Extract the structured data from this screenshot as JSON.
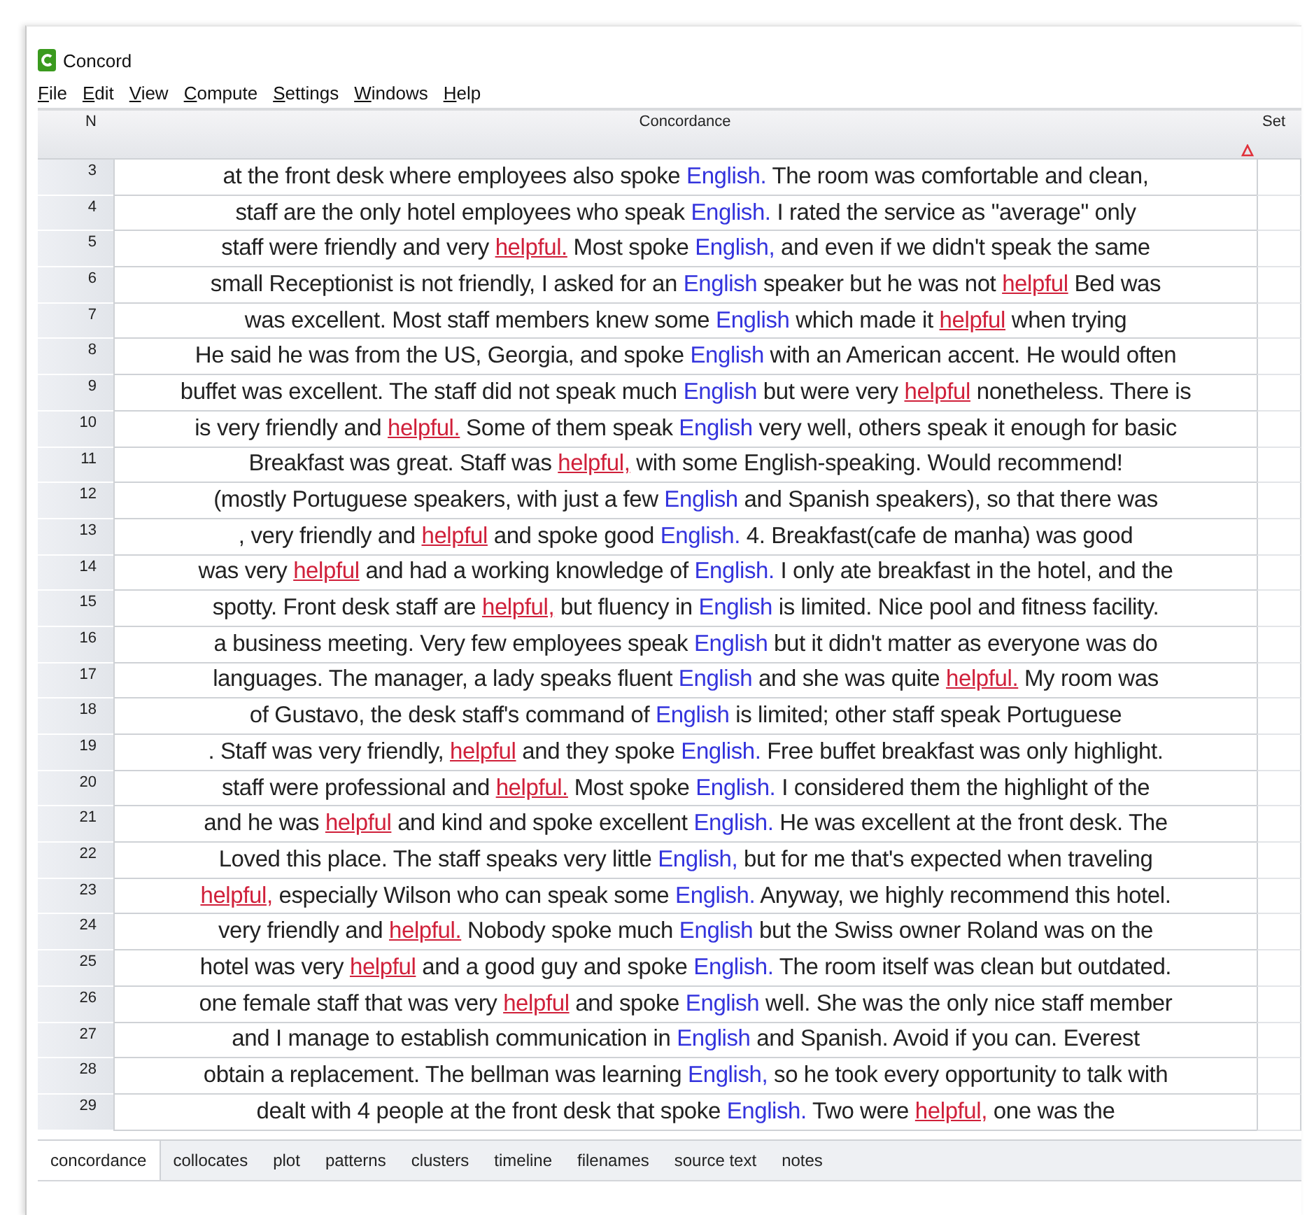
{
  "window": {
    "title": "Concord"
  },
  "menu": [
    {
      "label": "File"
    },
    {
      "label": "Edit"
    },
    {
      "label": "View"
    },
    {
      "label": "Compute"
    },
    {
      "label": "Settings"
    },
    {
      "label": "Windows"
    },
    {
      "label": "Help"
    }
  ],
  "table": {
    "columns": [
      "N",
      "Concordance",
      "Set"
    ],
    "rows": [
      {
        "n": "3",
        "segments": [
          {
            "kind": "plain",
            "text": "at the front desk where employees also spoke "
          },
          {
            "kind": "node",
            "text": "English."
          },
          {
            "kind": "plain",
            "text": " The room was comfortable and clean,"
          }
        ]
      },
      {
        "n": "4",
        "segments": [
          {
            "kind": "plain",
            "text": "staff are the only hotel employees who speak "
          },
          {
            "kind": "node",
            "text": "English."
          },
          {
            "kind": "plain",
            "text": " I rated the service as \"average\" only"
          }
        ]
      },
      {
        "n": "5",
        "segments": [
          {
            "kind": "plain",
            "text": "staff were friendly and very "
          },
          {
            "kind": "collocate",
            "text": "helpful."
          },
          {
            "kind": "plain",
            "text": " Most spoke "
          },
          {
            "kind": "node",
            "text": "English,"
          },
          {
            "kind": "plain",
            "text": " and even if we didn't speak the same"
          }
        ]
      },
      {
        "n": "6",
        "segments": [
          {
            "kind": "plain",
            "text": "small Receptionist is not friendly, I asked for an "
          },
          {
            "kind": "node",
            "text": "English"
          },
          {
            "kind": "plain",
            "text": " speaker but he was not "
          },
          {
            "kind": "collocate",
            "text": "helpful"
          },
          {
            "kind": "plain",
            "text": " Bed was"
          }
        ]
      },
      {
        "n": "7",
        "segments": [
          {
            "kind": "plain",
            "text": "was excellent. Most staff members knew some "
          },
          {
            "kind": "node",
            "text": "English"
          },
          {
            "kind": "plain",
            "text": " which made it "
          },
          {
            "kind": "collocate",
            "text": "helpful"
          },
          {
            "kind": "plain",
            "text": " when trying"
          }
        ]
      },
      {
        "n": "8",
        "segments": [
          {
            "kind": "plain",
            "text": "He said he was from the US, Georgia, and spoke "
          },
          {
            "kind": "node",
            "text": "English"
          },
          {
            "kind": "plain",
            "text": " with an American accent. He would often"
          }
        ]
      },
      {
        "n": "9",
        "segments": [
          {
            "kind": "plain",
            "text": "buffet was excellent. The staff did not speak much "
          },
          {
            "kind": "node",
            "text": "English"
          },
          {
            "kind": "plain",
            "text": " but were very "
          },
          {
            "kind": "collocate",
            "text": "helpful"
          },
          {
            "kind": "plain",
            "text": " nonetheless. There is"
          }
        ]
      },
      {
        "n": "10",
        "segments": [
          {
            "kind": "plain",
            "text": "is very friendly and "
          },
          {
            "kind": "collocate",
            "text": "helpful."
          },
          {
            "kind": "plain",
            "text": " Some of them speak "
          },
          {
            "kind": "node",
            "text": "English"
          },
          {
            "kind": "plain",
            "text": " very well, others speak it enough for basic"
          }
        ]
      },
      {
        "n": "11",
        "segments": [
          {
            "kind": "plain",
            "text": "Breakfast was great. Staff was "
          },
          {
            "kind": "collocate",
            "text": "helpful,"
          },
          {
            "kind": "plain",
            "text": " with some English-speaking. Would recommend!"
          }
        ]
      },
      {
        "n": "12",
        "segments": [
          {
            "kind": "plain",
            "text": "(mostly Portuguese speakers, with just a few "
          },
          {
            "kind": "node",
            "text": "English"
          },
          {
            "kind": "plain",
            "text": " and Spanish speakers), so that there was"
          }
        ]
      },
      {
        "n": "13",
        "segments": [
          {
            "kind": "plain",
            "text": ", very friendly and "
          },
          {
            "kind": "collocate",
            "text": "helpful"
          },
          {
            "kind": "plain",
            "text": " and spoke good "
          },
          {
            "kind": "node",
            "text": "English."
          },
          {
            "kind": "plain",
            "text": " 4. Breakfast(cafe de manha) was good"
          }
        ]
      },
      {
        "n": "14",
        "segments": [
          {
            "kind": "plain",
            "text": "was very "
          },
          {
            "kind": "collocate",
            "text": "helpful"
          },
          {
            "kind": "plain",
            "text": " and had a working knowledge of "
          },
          {
            "kind": "node",
            "text": "English."
          },
          {
            "kind": "plain",
            "text": " I only ate breakfast in the hotel, and the"
          }
        ]
      },
      {
        "n": "15",
        "segments": [
          {
            "kind": "plain",
            "text": "spotty. Front desk staff are "
          },
          {
            "kind": "collocate",
            "text": "helpful,"
          },
          {
            "kind": "plain",
            "text": " but fluency in "
          },
          {
            "kind": "node",
            "text": "English"
          },
          {
            "kind": "plain",
            "text": " is limited. Nice pool and fitness facility."
          }
        ]
      },
      {
        "n": "16",
        "segments": [
          {
            "kind": "plain",
            "text": "a business meeting. Very few employees speak "
          },
          {
            "kind": "node",
            "text": "English"
          },
          {
            "kind": "plain",
            "text": " but it didn't matter as everyone was do"
          }
        ]
      },
      {
        "n": "17",
        "segments": [
          {
            "kind": "plain",
            "text": "languages. The manager, a lady speaks fluent "
          },
          {
            "kind": "node",
            "text": "English"
          },
          {
            "kind": "plain",
            "text": " and she was quite "
          },
          {
            "kind": "collocate",
            "text": "helpful."
          },
          {
            "kind": "plain",
            "text": " My room was"
          }
        ]
      },
      {
        "n": "18",
        "segments": [
          {
            "kind": "plain",
            "text": "of Gustavo, the desk staff's command of "
          },
          {
            "kind": "node",
            "text": "English"
          },
          {
            "kind": "plain",
            "text": " is limited; other staff speak Portuguese"
          }
        ]
      },
      {
        "n": "19",
        "segments": [
          {
            "kind": "plain",
            "text": ". Staff was very friendly, "
          },
          {
            "kind": "collocate",
            "text": "helpful"
          },
          {
            "kind": "plain",
            "text": " and they spoke "
          },
          {
            "kind": "node",
            "text": "English."
          },
          {
            "kind": "plain",
            "text": " Free buffet breakfast was only highlight."
          }
        ]
      },
      {
        "n": "20",
        "segments": [
          {
            "kind": "plain",
            "text": "staff were professional and "
          },
          {
            "kind": "collocate",
            "text": "helpful."
          },
          {
            "kind": "plain",
            "text": " Most spoke "
          },
          {
            "kind": "node",
            "text": "English."
          },
          {
            "kind": "plain",
            "text": " I considered them the highlight of the"
          }
        ]
      },
      {
        "n": "21",
        "segments": [
          {
            "kind": "plain",
            "text": "and he was "
          },
          {
            "kind": "collocate",
            "text": "helpful"
          },
          {
            "kind": "plain",
            "text": " and kind and spoke excellent "
          },
          {
            "kind": "node",
            "text": "English."
          },
          {
            "kind": "plain",
            "text": " He was excellent at the front desk. The"
          }
        ]
      },
      {
        "n": "22",
        "segments": [
          {
            "kind": "plain",
            "text": "Loved this place. The staff speaks very little "
          },
          {
            "kind": "node",
            "text": "English,"
          },
          {
            "kind": "plain",
            "text": " but for me that's expected when traveling"
          }
        ]
      },
      {
        "n": "23",
        "segments": [
          {
            "kind": "collocate",
            "text": "helpful,"
          },
          {
            "kind": "plain",
            "text": " especially Wilson who can speak some "
          },
          {
            "kind": "node",
            "text": "English."
          },
          {
            "kind": "plain",
            "text": " Anyway, we highly recommend this hotel."
          }
        ]
      },
      {
        "n": "24",
        "segments": [
          {
            "kind": "plain",
            "text": "very friendly and "
          },
          {
            "kind": "collocate",
            "text": "helpful."
          },
          {
            "kind": "plain",
            "text": " Nobody spoke much "
          },
          {
            "kind": "node",
            "text": "English"
          },
          {
            "kind": "plain",
            "text": " but the Swiss owner Roland was on the"
          }
        ]
      },
      {
        "n": "25",
        "segments": [
          {
            "kind": "plain",
            "text": "hotel was very "
          },
          {
            "kind": "collocate",
            "text": "helpful"
          },
          {
            "kind": "plain",
            "text": " and a good guy and spoke "
          },
          {
            "kind": "node",
            "text": "English."
          },
          {
            "kind": "plain",
            "text": " The room itself was clean but outdated."
          }
        ]
      },
      {
        "n": "26",
        "segments": [
          {
            "kind": "plain",
            "text": "one female staff that was very "
          },
          {
            "kind": "collocate",
            "text": "helpful"
          },
          {
            "kind": "plain",
            "text": " and spoke "
          },
          {
            "kind": "node",
            "text": "English"
          },
          {
            "kind": "plain",
            "text": " well. She was the only nice staff member"
          }
        ]
      },
      {
        "n": "27",
        "segments": [
          {
            "kind": "plain",
            "text": "and I manage to establish communication in "
          },
          {
            "kind": "node",
            "text": "English"
          },
          {
            "kind": "plain",
            "text": " and Spanish. Avoid if you can. Everest"
          }
        ]
      },
      {
        "n": "28",
        "segments": [
          {
            "kind": "plain",
            "text": "obtain a replacement. The bellman was learning "
          },
          {
            "kind": "node",
            "text": "English,"
          },
          {
            "kind": "plain",
            "text": " so he took every opportunity to talk with"
          }
        ]
      },
      {
        "n": "29",
        "segments": [
          {
            "kind": "plain",
            "text": "dealt with 4 people at the front desk that spoke "
          },
          {
            "kind": "node",
            "text": "English."
          },
          {
            "kind": "plain",
            "text": " Two were "
          },
          {
            "kind": "collocate",
            "text": "helpful,"
          },
          {
            "kind": "plain",
            "text": " one was the"
          }
        ]
      }
    ]
  },
  "tabs": [
    {
      "label": "concordance",
      "selected": true
    },
    {
      "label": "collocates",
      "selected": false
    },
    {
      "label": "plot",
      "selected": false
    },
    {
      "label": "patterns",
      "selected": false
    },
    {
      "label": "clusters",
      "selected": false
    },
    {
      "label": "timeline",
      "selected": false
    },
    {
      "label": "filenames",
      "selected": false
    },
    {
      "label": "source text",
      "selected": false
    },
    {
      "label": "notes",
      "selected": false
    }
  ]
}
